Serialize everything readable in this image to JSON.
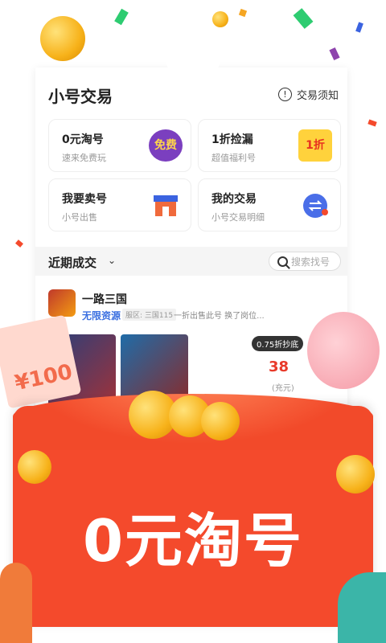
{
  "header": {
    "title": "小号交易",
    "notice_label": "交易须知",
    "notice_icon": "!"
  },
  "tiles": [
    {
      "title": "0元淘号",
      "subtitle": "速来免费玩",
      "icon_text": "免费",
      "icon": "free-badge-icon"
    },
    {
      "title": "1折捡漏",
      "subtitle": "超值福利号",
      "icon_text": "1折",
      "icon": "discount-tag-icon"
    },
    {
      "title": "我要卖号",
      "subtitle": "小号出售",
      "icon": "shop-icon"
    },
    {
      "title": "我的交易",
      "subtitle": "小号交易明细",
      "icon": "swap-icon"
    }
  ],
  "recent": {
    "label": "近期成交",
    "search_placeholder": "搜索找号"
  },
  "listing": {
    "game_name": "一路三国",
    "tag": "无限资源",
    "server": "服区: 三国115",
    "description": "一折出售此号 换了岗位...",
    "discount_badge": "0.75折抄底",
    "price": "38",
    "price_unit": "(充元)"
  },
  "ticket_value": "¥100",
  "banner_text": "0元淘号",
  "colors": {
    "envelope": "#f44a2c",
    "price": "#e83a2a",
    "link": "#3a6fe0",
    "swap_circle": "#4a6ee8"
  }
}
